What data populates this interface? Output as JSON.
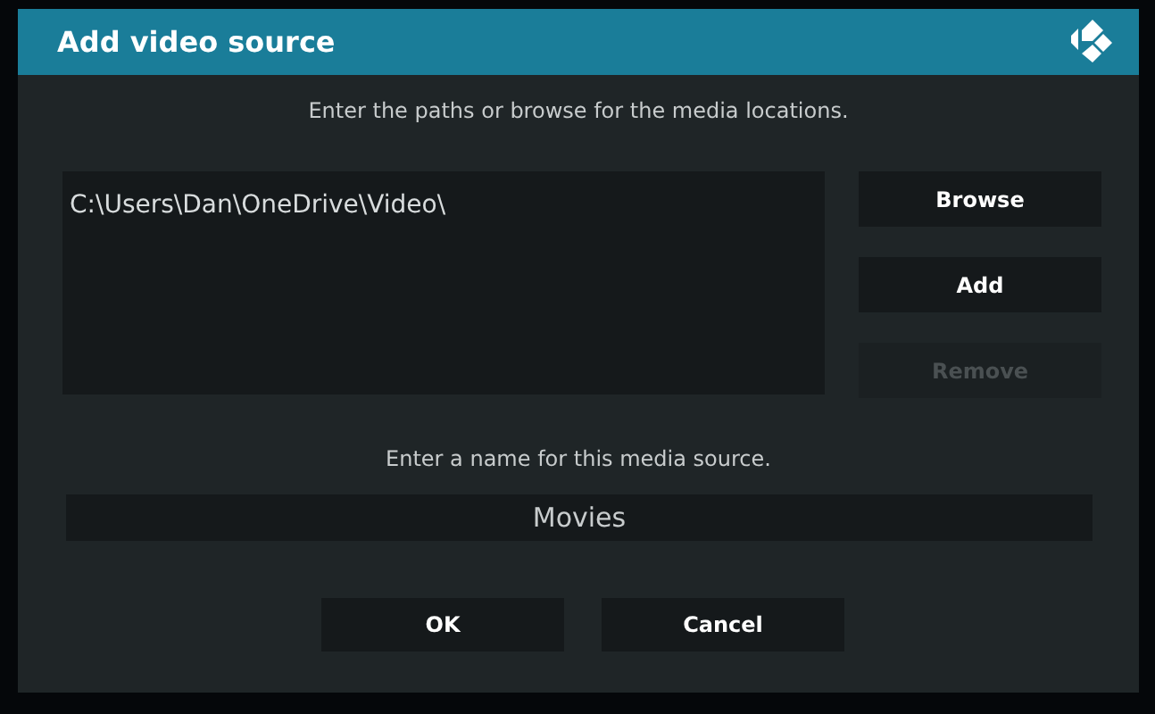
{
  "dialog": {
    "title": "Add video source",
    "paths_prompt": "Enter the paths or browse for the media locations.",
    "paths": [
      "C:\\Users\\Dan\\OneDrive\\Video\\"
    ],
    "side_buttons": [
      {
        "label": "Browse",
        "disabled": false
      },
      {
        "label": "Add",
        "disabled": false
      },
      {
        "label": "Remove",
        "disabled": true
      }
    ],
    "name_prompt": "Enter a name for this media source.",
    "name_field": {
      "value": "Movies"
    },
    "buttons": [
      {
        "label": "OK"
      },
      {
        "label": "Cancel"
      }
    ]
  }
}
